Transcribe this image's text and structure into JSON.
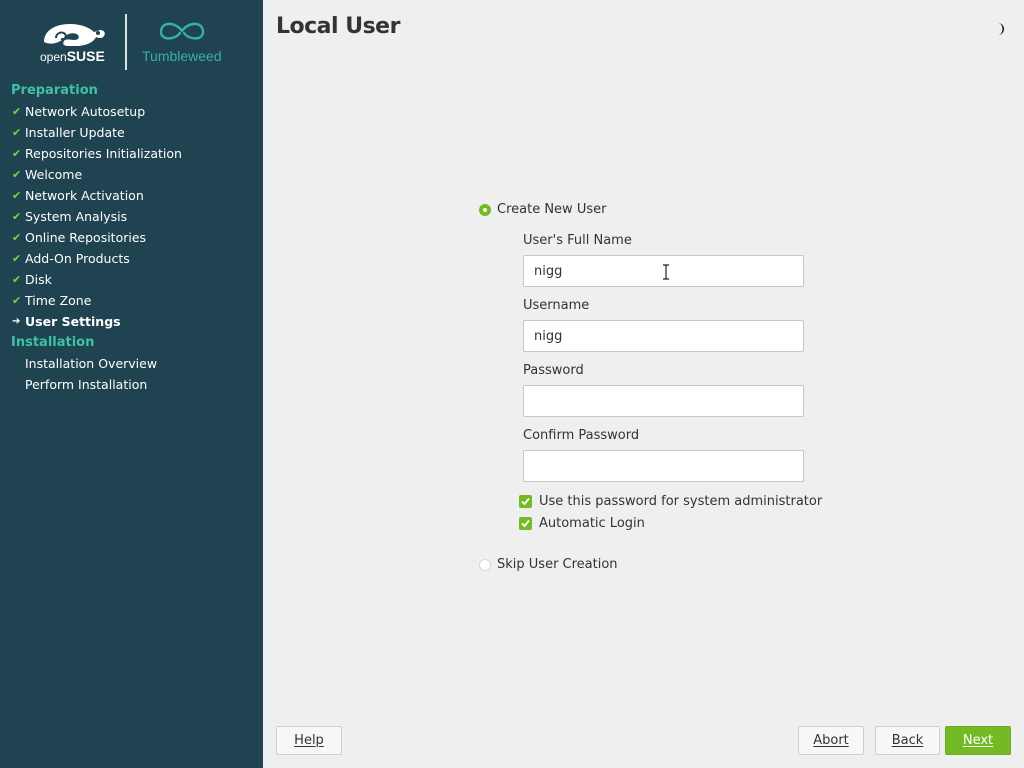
{
  "branding": {
    "product": "openSUSE",
    "product_light": "open",
    "product_bold": "SUSE",
    "edition": "Tumbleweed"
  },
  "sidebar": {
    "sections": [
      {
        "title": "Preparation",
        "steps": [
          {
            "label": "Network Autosetup",
            "status": "done"
          },
          {
            "label": "Installer Update",
            "status": "done"
          },
          {
            "label": "Repositories Initialization",
            "status": "done"
          },
          {
            "label": "Welcome",
            "status": "done"
          },
          {
            "label": "Network Activation",
            "status": "done"
          },
          {
            "label": "System Analysis",
            "status": "done"
          },
          {
            "label": "Online Repositories",
            "status": "done"
          },
          {
            "label": "Add-On Products",
            "status": "done"
          },
          {
            "label": "Disk",
            "status": "done"
          },
          {
            "label": "Time Zone",
            "status": "done"
          },
          {
            "label": "User Settings",
            "status": "current"
          }
        ]
      },
      {
        "title": "Installation",
        "steps": [
          {
            "label": "Installation Overview",
            "status": "pending"
          },
          {
            "label": "Perform Installation",
            "status": "pending"
          }
        ]
      }
    ]
  },
  "page": {
    "title": "Local User"
  },
  "form": {
    "create_option": "Create New User",
    "full_name_label": "User's Full Name",
    "full_name_value": "nigg",
    "username_label": "Username",
    "username_value": "nigg",
    "password_label": "Password",
    "password_value": "",
    "confirm_label": "Confirm Password",
    "confirm_value": "",
    "admin_checkbox": "Use this password for system administrator",
    "admin_checked": true,
    "autologin_checkbox": "Automatic Login",
    "autologin_checked": true,
    "skip_option": "Skip User Creation",
    "selected_option": "create"
  },
  "buttons": {
    "help": "Help",
    "abort": "Abort",
    "back": "Back",
    "next": "Next"
  },
  "colors": {
    "sidebar_bg": "#1f4350",
    "accent_green": "#73ba25",
    "heading_teal": "#3fc1a8",
    "check_green": "#7dd24a"
  },
  "icons": {
    "logo": "opensuse-chameleon-logo",
    "edition_logo": "tumbleweed-infinity-logo",
    "theme": "contrast-half-moon-icon",
    "done": "checkmark-icon",
    "current": "arrow-right-icon"
  }
}
